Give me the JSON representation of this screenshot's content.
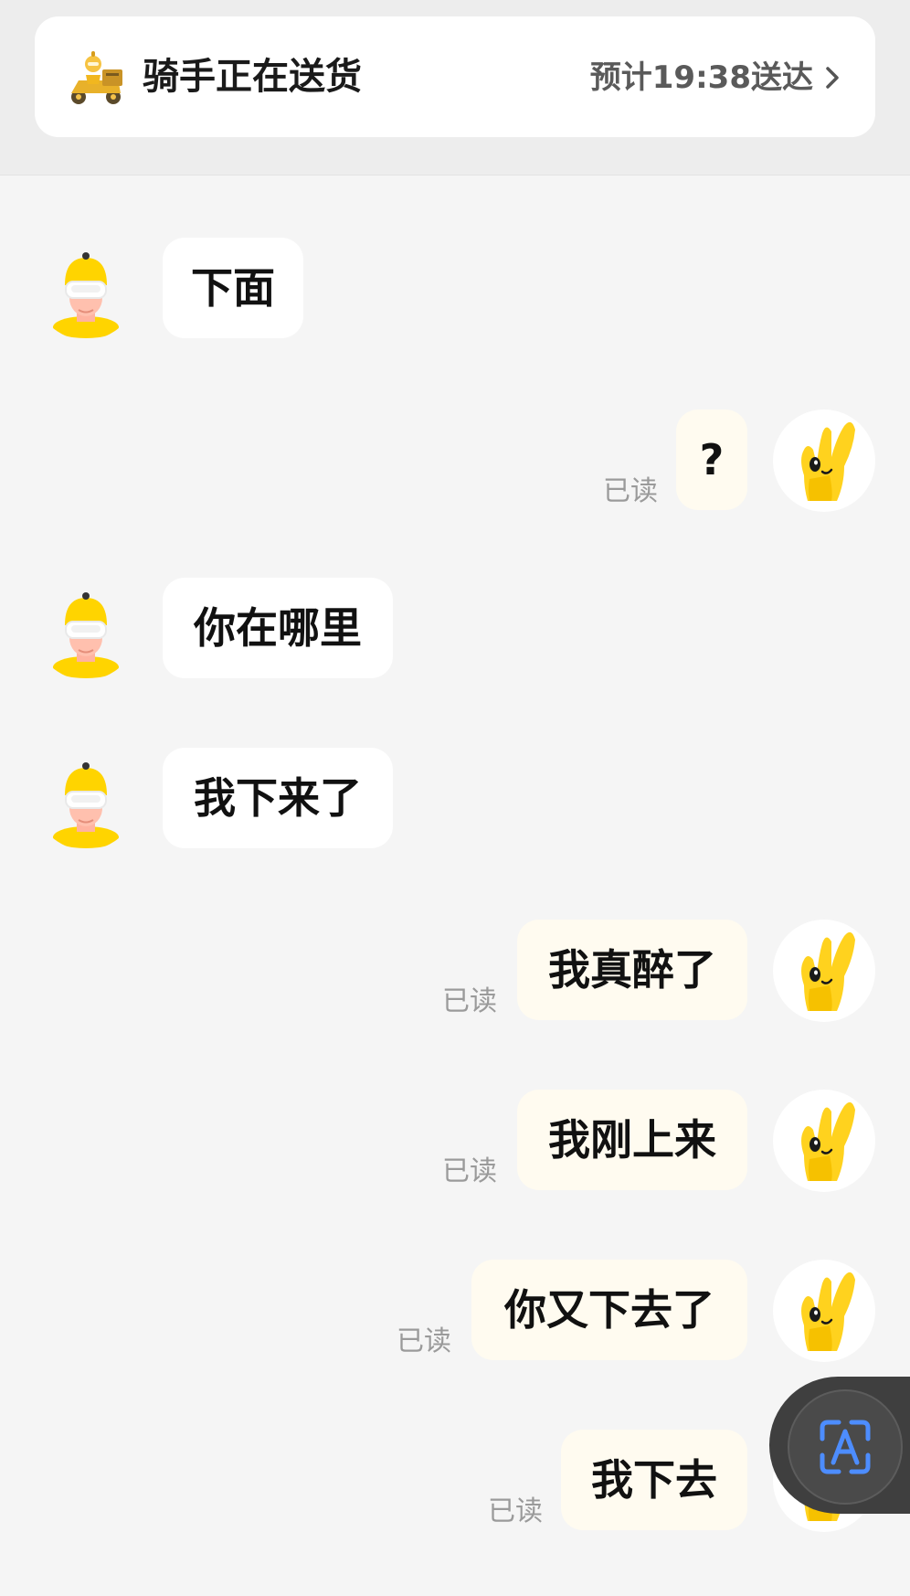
{
  "header": {
    "status_title": "骑手正在送货",
    "eta": "预计19:38送达"
  },
  "messages": [
    {
      "side": "in",
      "text": "下面"
    },
    {
      "side": "out",
      "text": "?",
      "receipt": "已读"
    },
    {
      "side": "in",
      "text": "你在哪里"
    },
    {
      "side": "in",
      "text": "我下来了"
    },
    {
      "side": "out",
      "text": "我真醉了",
      "receipt": "已读"
    },
    {
      "side": "out",
      "text": "我刚上来",
      "receipt": "已读"
    },
    {
      "side": "out",
      "text": "你又下去了",
      "receipt": "已读"
    },
    {
      "side": "out",
      "text": "我下去",
      "receipt": "已读"
    }
  ],
  "icons": {
    "status": "delivery-scooter-icon",
    "chevron": "chevron-right-icon",
    "rider_avatar": "rider-avatar-icon",
    "user_avatar": "yellow-hand-avatar-icon",
    "floating_button": "text-recognition-icon"
  },
  "colors": {
    "accent_yellow": "#ffd21e",
    "floating_icon_blue": "#4d8dff"
  }
}
